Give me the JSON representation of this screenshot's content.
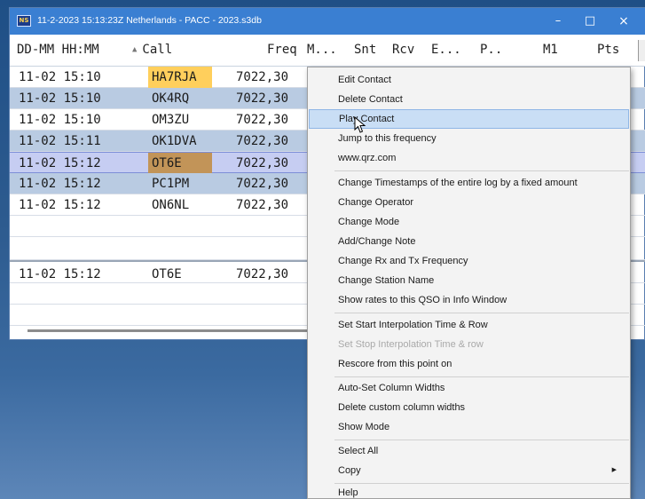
{
  "window": {
    "title": "11-2-2023 15:13:23Z  Netherlands - PACC - 2023.s3db",
    "icon_label": "NS",
    "minimize": "–",
    "maximize": "□",
    "close": "×"
  },
  "columns": {
    "date_time": "DD-MM HH:MM",
    "call": "Call",
    "freq": "Freq",
    "mode": "M...",
    "snt": "Snt",
    "rcv": "Rcv",
    "e": "E...",
    "p": "P..",
    "m1": "M1",
    "pts": "Pts"
  },
  "rows": [
    {
      "datetime": "11-02 15:10",
      "call": "HA7RJA",
      "freq": "7022,30"
    },
    {
      "datetime": "11-02 15:10",
      "call": "OK4RQ",
      "freq": "7022,30"
    },
    {
      "datetime": "11-02 15:10",
      "call": "OM3ZU",
      "freq": "7022,30"
    },
    {
      "datetime": "11-02 15:11",
      "call": "OK1DVA",
      "freq": "7022,30"
    },
    {
      "datetime": "11-02 15:12",
      "call": "OT6E",
      "freq": "7022,30"
    },
    {
      "datetime": "11-02 15:12",
      "call": "PC1PM",
      "freq": "7022,30"
    },
    {
      "datetime": "11-02 15:12",
      "call": "ON6NL",
      "freq": "7022,30"
    },
    {
      "datetime": "11-02 15:12",
      "call": "OT6E",
      "freq": "7022,30"
    }
  ],
  "context_menu": {
    "items": [
      "Edit Contact",
      "Delete Contact",
      "Play Contact",
      "Jump to this frequency",
      "www.qrz.com",
      "Change Timestamps of the entire log by a fixed amount",
      "Change Operator",
      "Change Mode",
      "Add/Change Note",
      "Change Rx and Tx Frequency",
      "Change Station Name",
      "Show rates to this QSO in Info Window",
      "Set Start Interpolation Time & Row",
      "Set Stop Interpolation Time & row",
      "Rescore from this point on",
      "Auto-Set Column Widths",
      "Delete custom column widths",
      "Show Mode",
      "Select All",
      "Copy",
      "Help"
    ],
    "hovered": "Play Contact",
    "disabled": [
      "Set Stop Interpolation Time & row"
    ],
    "submenu_arrow": "▶"
  },
  "colors": {
    "titlebar": "#3a7fd2",
    "row_alt": "#b9cbe2",
    "row_selected": "#c6cdf2",
    "call_highlight_yellow": "#ffcf5c",
    "call_highlight_brown": "#c29458"
  }
}
